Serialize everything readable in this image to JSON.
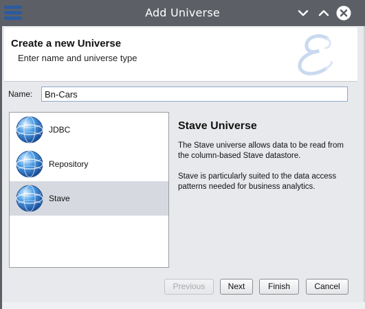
{
  "window": {
    "title": "Add Universe",
    "menu_icon": "hamburger-icon",
    "controls": [
      "minimize-icon",
      "maximize-icon",
      "close-icon"
    ]
  },
  "header": {
    "title": "Create a new Universe",
    "subtitle": "Enter name and universe type",
    "logo_icon": "script-e-logo"
  },
  "form": {
    "name_label": "Name:",
    "name_value": "Bn-Cars"
  },
  "universe_types": {
    "items": [
      {
        "label": "JDBC",
        "icon": "globe-icon",
        "selected": false
      },
      {
        "label": "Repository",
        "icon": "globe-icon",
        "selected": false
      },
      {
        "label": "Stave",
        "icon": "globe-icon",
        "selected": true
      }
    ]
  },
  "description": {
    "title": "Stave Universe",
    "paragraph1": "The Stave universe allows data to be read from the column-based Stave datastore.",
    "paragraph2": "Stave is particularly suited to the data access patterns needed for business analytics."
  },
  "buttons": {
    "previous": "Previous",
    "next": "Next",
    "finish": "Finish",
    "cancel": "Cancel"
  },
  "colors": {
    "titlebar": "#5c6066",
    "selected_row": "#d6d9df",
    "accent": "#2d5a9e"
  }
}
